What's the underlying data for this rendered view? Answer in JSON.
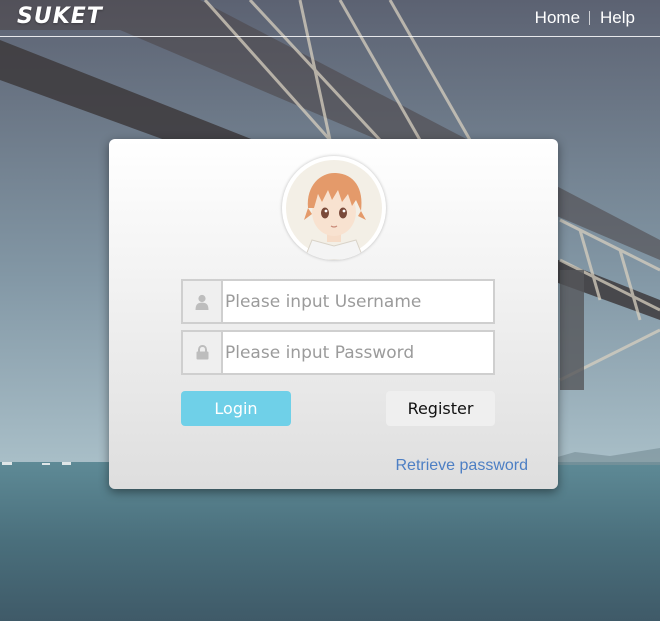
{
  "header": {
    "logo": "SUKET",
    "nav": [
      {
        "label": "Home"
      },
      {
        "label": "Help"
      }
    ]
  },
  "login": {
    "username_placeholder": "Please input Username",
    "password_placeholder": "Please input Password",
    "username_icon": "user-icon",
    "password_icon": "lock-icon",
    "login_label": "Login",
    "register_label": "Register",
    "retrieve_label": "Retrieve password"
  },
  "colors": {
    "login_button": "#6fd0e8",
    "link": "#4d7fc4"
  }
}
